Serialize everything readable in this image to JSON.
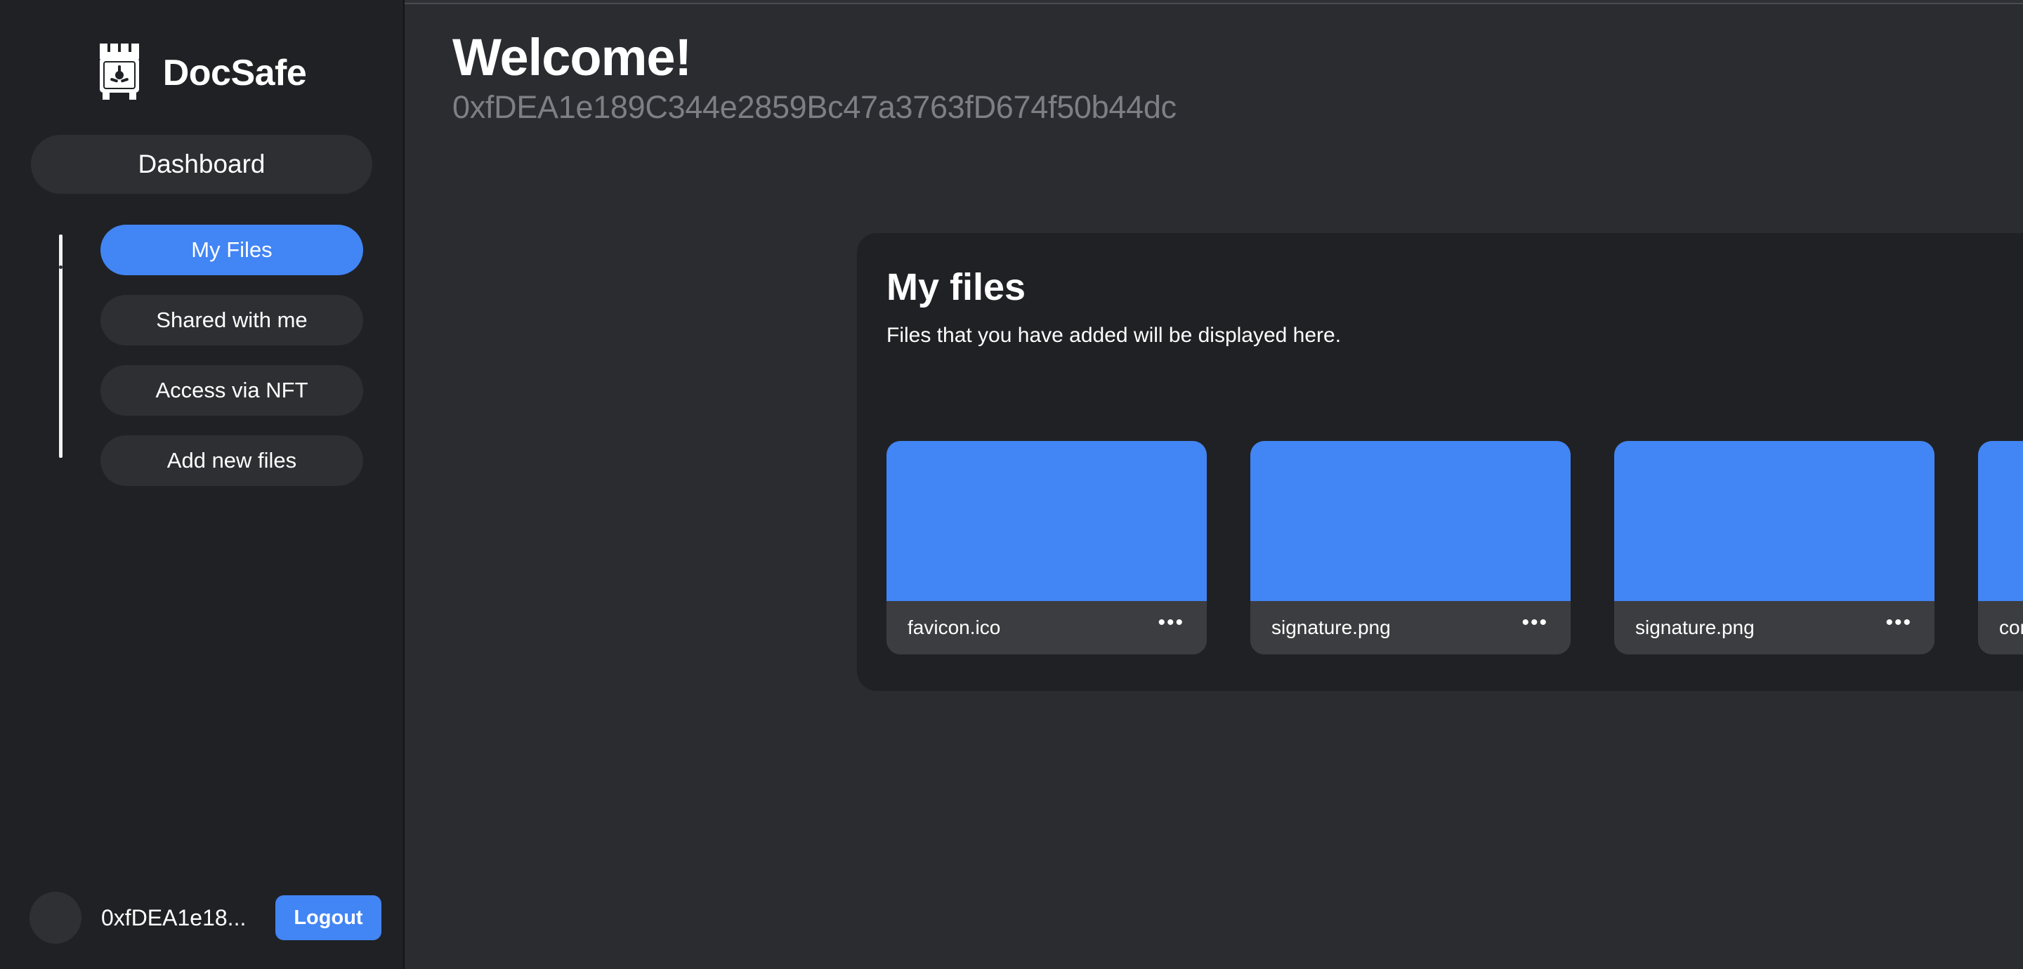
{
  "brand": {
    "name": "DocSafe",
    "logo_icon": "safe-vault-icon"
  },
  "colors": {
    "accent_blue": "#4285f4",
    "sidebar_bg": "#202125",
    "main_bg": "#2b2c30",
    "card_bg": "#202125",
    "file_footer_bg": "#3c3d40",
    "muted_text": "#7d7f85"
  },
  "sidebar": {
    "dashboard_label": "Dashboard",
    "nav_items": [
      {
        "label": "My Files",
        "active": true
      },
      {
        "label": "Shared with me",
        "active": false
      },
      {
        "label": "Access via NFT",
        "active": false
      },
      {
        "label": "Add new files",
        "active": false
      }
    ],
    "account": {
      "address_short": "0xfDEA1e18...",
      "logout_label": "Logout"
    }
  },
  "header": {
    "title": "Welcome!",
    "wallet_address": "0xfDEA1e189C344e2859Bc47a3763fD674f50b44dc"
  },
  "files_panel": {
    "title": "My files",
    "subtitle": "Files that you have added will be displayed here.",
    "menu_glyph": "•••",
    "files": [
      {
        "name": "favicon.ico"
      },
      {
        "name": "signature.png"
      },
      {
        "name": "signature.png"
      },
      {
        "name": "confidential-doc.pdf"
      },
      {
        "name": ""
      }
    ]
  }
}
